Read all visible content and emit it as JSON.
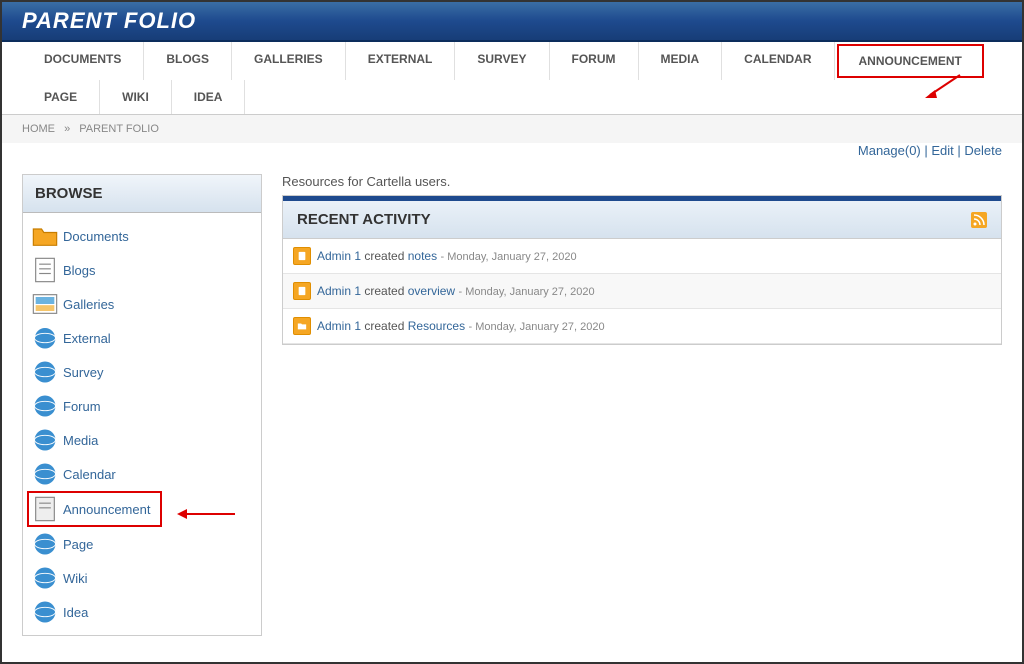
{
  "header": {
    "title": "PARENT FOLIO"
  },
  "tabs": [
    "DOCUMENTS",
    "BLOGS",
    "GALLERIES",
    "EXTERNAL",
    "SURVEY",
    "FORUM",
    "MEDIA",
    "CALENDAR",
    "ANNOUNCEMENT",
    "PAGE",
    "WIKI",
    "IDEA"
  ],
  "breadcrumb": {
    "home": "HOME",
    "sep": "»",
    "current": "PARENT FOLIO"
  },
  "top_links": {
    "manage": "Manage(0)",
    "edit": "Edit",
    "delete": "Delete",
    "sep": " | "
  },
  "desc": "Resources for Cartella users.",
  "sidebar": {
    "header": "BROWSE",
    "items": [
      {
        "label": "Documents",
        "icon": "folder"
      },
      {
        "label": "Blogs",
        "icon": "doc"
      },
      {
        "label": "Galleries",
        "icon": "img"
      },
      {
        "label": "External",
        "icon": "globe"
      },
      {
        "label": "Survey",
        "icon": "globe"
      },
      {
        "label": "Forum",
        "icon": "globe"
      },
      {
        "label": "Media",
        "icon": "globe"
      },
      {
        "label": "Calendar",
        "icon": "globe"
      },
      {
        "label": "Announcement",
        "icon": "ann"
      },
      {
        "label": "Page",
        "icon": "globe"
      },
      {
        "label": "Wiki",
        "icon": "globe"
      },
      {
        "label": "Idea",
        "icon": "globe"
      }
    ]
  },
  "panel": {
    "title": "RECENT ACTIVITY",
    "rows": [
      {
        "user": "Admin 1",
        "action": "created",
        "obj": "notes",
        "date": "Monday, January 27, 2020",
        "icon": "doc"
      },
      {
        "user": "Admin 1",
        "action": "created",
        "obj": "overview",
        "date": "Monday, January 27, 2020",
        "icon": "doc"
      },
      {
        "user": "Admin 1",
        "action": "created",
        "obj": "Resources",
        "date": "Monday, January 27, 2020",
        "icon": "folder"
      }
    ]
  }
}
